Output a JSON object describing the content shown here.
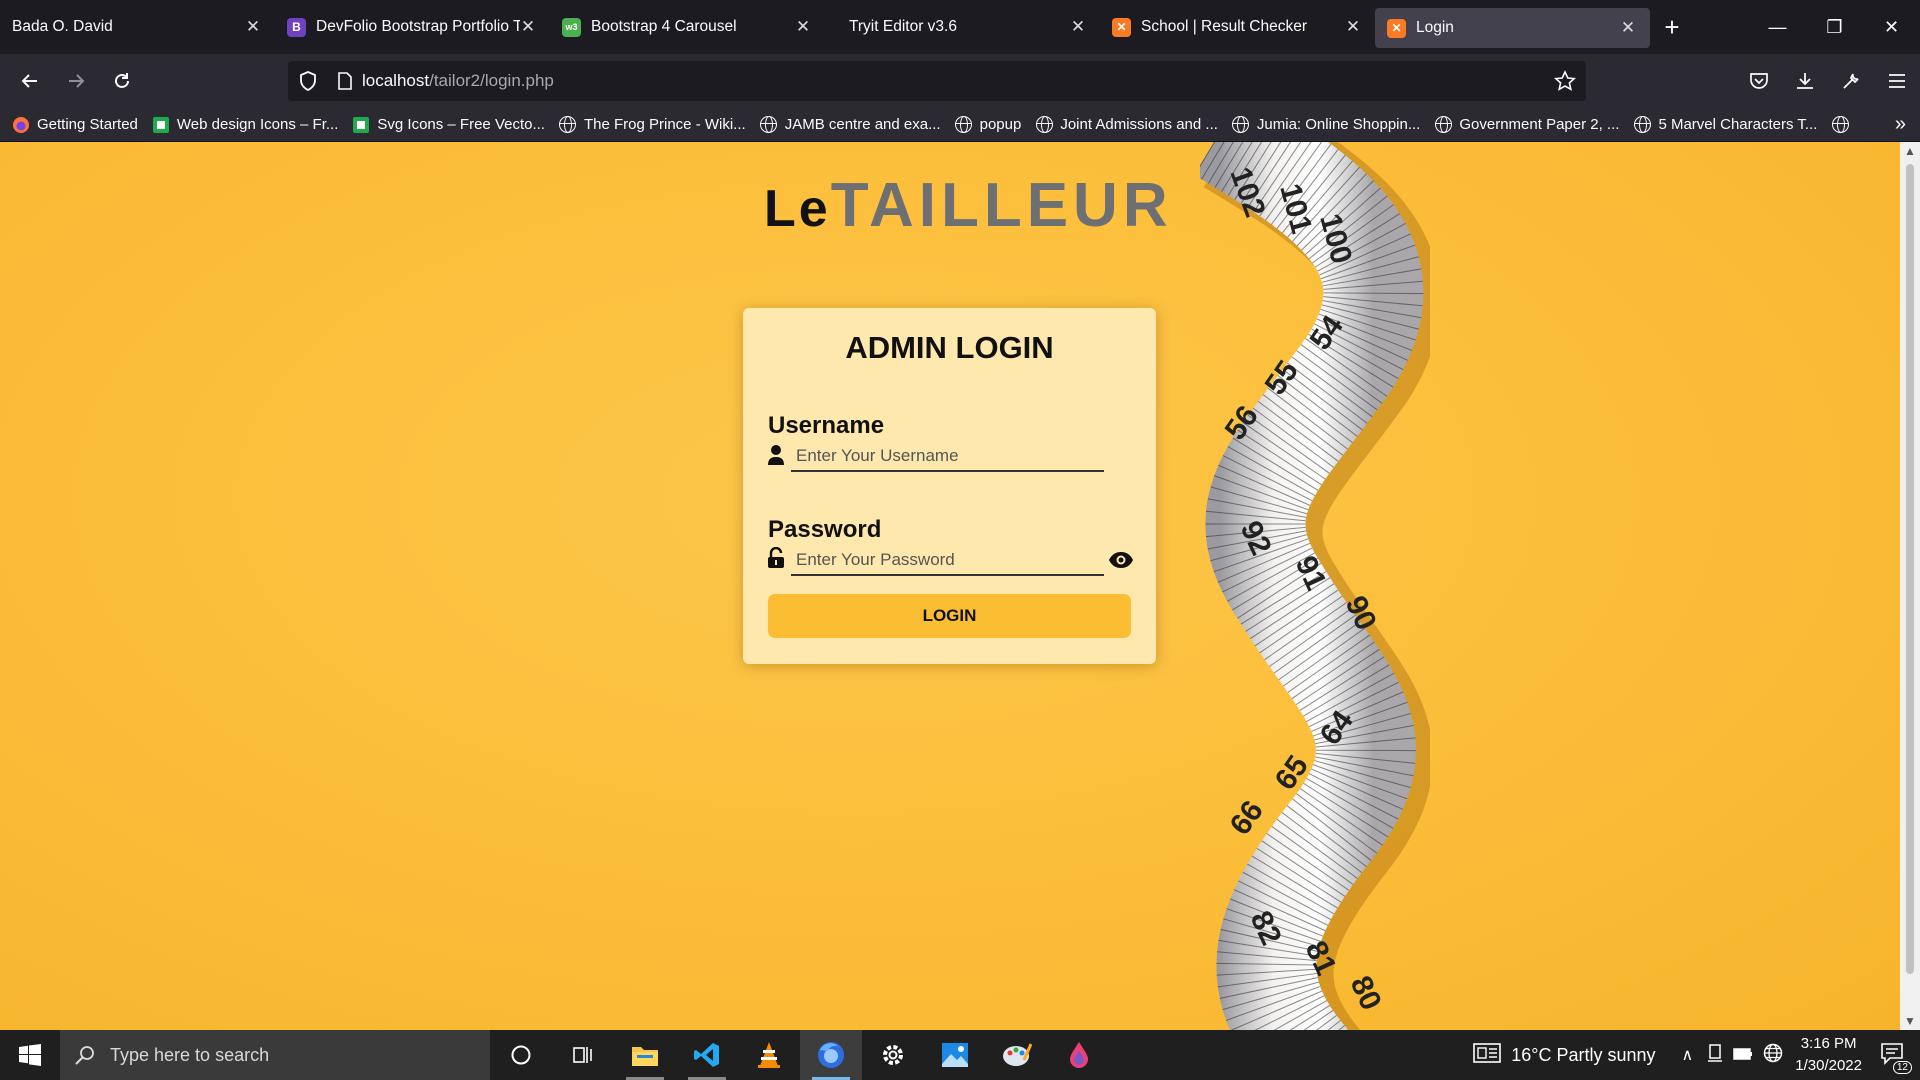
{
  "browser": {
    "tabs": [
      {
        "title": "Bada O. David",
        "favicon": "none",
        "color": ""
      },
      {
        "title": "DevFolio Bootstrap Portfolio Te",
        "favicon": "B",
        "color": "#6f42c1"
      },
      {
        "title": "Bootstrap 4 Carousel",
        "favicon": "w3",
        "color": "#4caf50"
      },
      {
        "title": "Tryit Editor v3.6",
        "favicon": "none",
        "color": ""
      },
      {
        "title": "School | Result Checker",
        "favicon": "xampp",
        "color": "#fb7a24"
      },
      {
        "title": "Login",
        "favicon": "xampp",
        "color": "#fb7a24"
      }
    ],
    "active_tab": 5,
    "url_host": "localhost",
    "url_path": "/tailor2/login.php",
    "bookmarks": [
      {
        "label": "Getting Started",
        "icon": "firefox-icon"
      },
      {
        "label": "Web design Icons – Fr...",
        "icon": "green-square-icon"
      },
      {
        "label": "Svg Icons – Free Vecto...",
        "icon": "green-square-icon"
      },
      {
        "label": "The Frog Prince - Wiki...",
        "icon": "globe-icon"
      },
      {
        "label": "JAMB centre  and exa...",
        "icon": "globe-icon"
      },
      {
        "label": "popup",
        "icon": "globe-icon"
      },
      {
        "label": "Joint Admissions and ...",
        "icon": "globe-icon"
      },
      {
        "label": "Jumia: Online Shoppin...",
        "icon": "globe-icon"
      },
      {
        "label": "Government Paper 2, ...",
        "icon": "globe-icon"
      },
      {
        "label": "5 Marvel Characters T...",
        "icon": "globe-icon"
      }
    ]
  },
  "page": {
    "logo_le": "Le",
    "logo_tailleur": "TAILLEUR",
    "login_title": "ADMIN LOGIN",
    "username_label": "Username",
    "username_placeholder": "Enter Your Username",
    "password_label": "Password",
    "password_placeholder": "Enter Your Password",
    "login_button": "LOGIN",
    "tape_numbers": [
      "102",
      "101",
      "100",
      "54",
      "55",
      "56",
      "92",
      "91",
      "90",
      "64",
      "65",
      "66",
      "82",
      "81",
      "80"
    ]
  },
  "taskbar": {
    "search_placeholder": "Type here to search",
    "weather": "16°C  Partly sunny",
    "time": "3:16 PM",
    "date": "1/30/2022",
    "notification_count": "12"
  },
  "colors": {
    "background": "#fbbd38",
    "card": "#ffe8ad",
    "button": "#fbbd32",
    "logo_dark": "#111111",
    "logo_gray": "#6e6f73"
  }
}
